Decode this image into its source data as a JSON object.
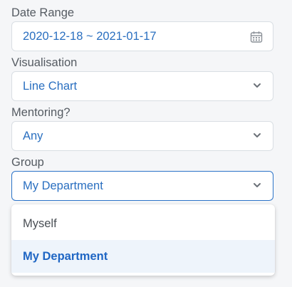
{
  "filters": {
    "date_range": {
      "label": "Date Range",
      "value": "2020-12-18 ~ 2021-01-17",
      "icon": "calendar-icon"
    },
    "visualisation": {
      "label": "Visualisation",
      "value": "Line Chart",
      "icon": "chevron-down-icon"
    },
    "mentoring": {
      "label": "Mentoring?",
      "value": "Any",
      "icon": "chevron-down-icon"
    },
    "group": {
      "label": "Group",
      "value": "My Department",
      "icon": "chevron-down-icon",
      "options": [
        "Myself",
        "My Department"
      ],
      "selected_option": "My Department"
    }
  },
  "colors": {
    "accent": "#2a6fc0",
    "active_border": "#2b73c8",
    "selected_bg": "#eef4fb",
    "label_text": "#555b62"
  }
}
